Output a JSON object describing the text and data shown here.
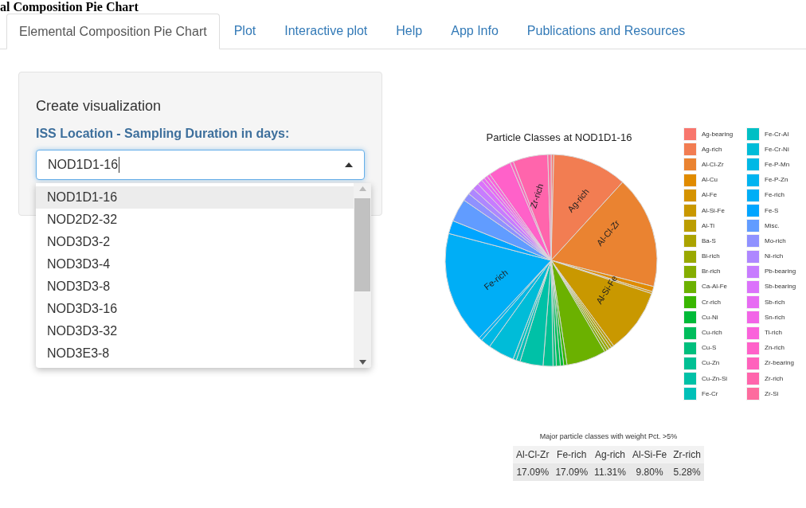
{
  "page_heading": "al Composition Pie Chart",
  "tabs": [
    {
      "label": "Elemental Composition Pie Chart",
      "selected": true
    },
    {
      "label": "Plot",
      "selected": false
    },
    {
      "label": "Interactive plot",
      "selected": false
    },
    {
      "label": "Help",
      "selected": false
    },
    {
      "label": "App Info",
      "selected": false
    },
    {
      "label": "Publications and Resources",
      "selected": false
    }
  ],
  "sidebar": {
    "title": "Create visualization",
    "field_label": "ISS Location - Sampling Duration in days:",
    "select": {
      "value": "NOD1D1-16",
      "expanded": true,
      "options": [
        {
          "label": "NOD1D1-16",
          "selected": true
        },
        {
          "label": "NOD2D2-32",
          "selected": false
        },
        {
          "label": "NOD3D3-2",
          "selected": false
        },
        {
          "label": "NOD3D3-4",
          "selected": false
        },
        {
          "label": "NOD3D3-8",
          "selected": false
        },
        {
          "label": "NOD3D3-16",
          "selected": false
        },
        {
          "label": "NOD3D3-32",
          "selected": false
        },
        {
          "label": "NOD3E3-8",
          "selected": false
        }
      ]
    }
  },
  "pie": {
    "title": "Particle Classes at NOD1D1-16",
    "slice_labels": [
      "Zr-rich",
      "Ag-rich",
      "Al-Cl-Zr",
      "Al-Si-Fe",
      "Fe-rich"
    ],
    "legend": [
      {
        "label": "Ag-bearing",
        "color": "#f8766d"
      },
      {
        "label": "Ag-rich",
        "color": "#f27d52"
      },
      {
        "label": "Al-Cl-Zr",
        "color": "#ea8331"
      },
      {
        "label": "Al-Cu",
        "color": "#e08b00"
      },
      {
        "label": "Al-Fe",
        "color": "#d59300"
      },
      {
        "label": "Al-Si-Fe",
        "color": "#c99800"
      },
      {
        "label": "Al-Ti",
        "color": "#bb9d00"
      },
      {
        "label": "Ba-S",
        "color": "#aba300"
      },
      {
        "label": "Bi-rich",
        "color": "#99a800"
      },
      {
        "label": "Br-rich",
        "color": "#85ad00"
      },
      {
        "label": "Ca-Al-Fe",
        "color": "#6bb100"
      },
      {
        "label": "Cr-rich",
        "color": "#39b600"
      },
      {
        "label": "Cu-Ni",
        "color": "#00ba38"
      },
      {
        "label": "Cu-rich",
        "color": "#00bd5c"
      },
      {
        "label": "Cu-S",
        "color": "#00bf7d"
      },
      {
        "label": "Cu-Zn",
        "color": "#00c094"
      },
      {
        "label": "Cu-Zn-Si",
        "color": "#00c1a7"
      },
      {
        "label": "Fe-Cr",
        "color": "#00c0b8"
      },
      {
        "label": "Fe-Cr-Al",
        "color": "#00bfc4"
      },
      {
        "label": "Fe-Cr-Ni",
        "color": "#00bcd8"
      },
      {
        "label": "Fe-P-Mn",
        "color": "#00b8e5"
      },
      {
        "label": "Fe-P-Zn",
        "color": "#00b4f0"
      },
      {
        "label": "Fe-rich",
        "color": "#00aef6"
      },
      {
        "label": "Fe-S",
        "color": "#00a5ff"
      },
      {
        "label": "Misc.",
        "color": "#619cff"
      },
      {
        "label": "Mo-rich",
        "color": "#8f91ff"
      },
      {
        "label": "Ni-rich",
        "color": "#ae87ff"
      },
      {
        "label": "Pb-bearing",
        "color": "#c77cff"
      },
      {
        "label": "Sb-bearing",
        "color": "#db72fb"
      },
      {
        "label": "Sb-rich",
        "color": "#e76bf3"
      },
      {
        "label": "Sn-rich",
        "color": "#f265e7"
      },
      {
        "label": "Ti-rich",
        "color": "#fa62db"
      },
      {
        "label": "Zn-rich",
        "color": "#ff61c9"
      },
      {
        "label": "Zr-bearing",
        "color": "#ff62bc"
      },
      {
        "label": "Zr-rich",
        "color": "#ff65ac"
      },
      {
        "label": "Zr-Si",
        "color": "#fd6c9e"
      }
    ]
  },
  "major_table": {
    "caption": "Major particle classes with weight Pct. >5%",
    "columns": [
      "Al-Cl-Zr",
      "Fe-rich",
      "Ag-rich",
      "Al-Si-Fe",
      "Zr-rich"
    ],
    "values": [
      "17.09%",
      "17.09%",
      "11.31%",
      "9.80%",
      "5.28%"
    ]
  }
}
